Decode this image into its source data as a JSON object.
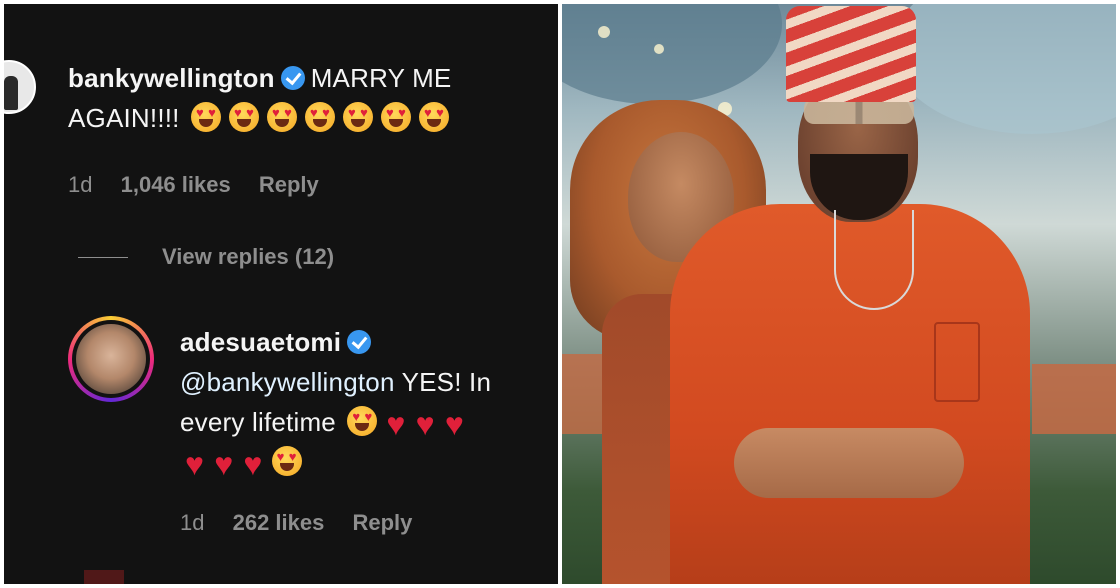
{
  "comment1": {
    "username": "bankywellington",
    "verified": true,
    "text_line1": "MARRY ME",
    "text_line2": "AGAIN!!!!",
    "emoji": [
      "heart-eyes",
      "heart-eyes",
      "heart-eyes",
      "heart-eyes",
      "heart-eyes",
      "heart-eyes",
      "heart-eyes"
    ],
    "time": "1d",
    "likes": "1,046 likes",
    "reply_label": "Reply",
    "view_replies_label": "View replies (12)"
  },
  "comment2": {
    "username": "adesuaetomi",
    "verified": true,
    "mention": "@bankywellington",
    "text_a": "YES! In",
    "text_b": "every lifetime",
    "time": "1d",
    "likes": "262 likes",
    "reply_label": "Reply"
  },
  "colors": {
    "background": "#121212",
    "text": "#f5f5f5",
    "meta": "#8e8e8e",
    "verified_badge": "#3897f0",
    "heart": "#e0203a"
  },
  "icons": [
    "verified-badge-icon",
    "heart-eyes-emoji-icon",
    "red-heart-emoji-icon"
  ]
}
